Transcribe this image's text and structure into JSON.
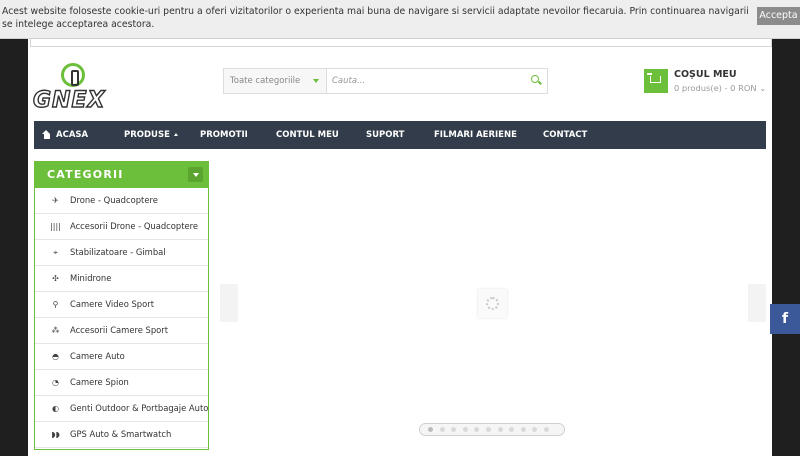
{
  "cookie_bar": {
    "text": "Acest website foloseste cookie-uri pentru a oferi vizitatorilor o experienta mai buna de navigare si servicii adaptate nevoilor fiecaruia. Prin continuarea navigarii se intelege acceptarea acestora.",
    "accept_label": "Accepta"
  },
  "header": {
    "logo_text": "GNEX",
    "search": {
      "category_selected": "Toate categoriile",
      "placeholder": "Cauta..."
    },
    "cart": {
      "title": "COȘUL MEU",
      "summary": "0 produs(e) - 0 RON ⌄"
    }
  },
  "nav": {
    "items": [
      {
        "label": "ACASA",
        "icon": "home-icon"
      },
      {
        "label": "PRODUSE",
        "has_dropdown": true
      },
      {
        "label": "PROMOTII"
      },
      {
        "label": "CONTUL MEU"
      },
      {
        "label": "SUPORT"
      },
      {
        "label": "FILMARI AERIENE"
      },
      {
        "label": "CONTACT"
      }
    ]
  },
  "categories": {
    "title": "CATEGORII",
    "items": [
      {
        "label": "Drone - Quadcoptere",
        "icon": "drone-icon",
        "glyph": "✈"
      },
      {
        "label": "Accesorii Drone - Quadcoptere",
        "icon": "drone-accessories-icon",
        "glyph": "||||"
      },
      {
        "label": "Stabilizatoare - Gimbal",
        "icon": "gimbal-icon",
        "glyph": "⌖"
      },
      {
        "label": "Minidrone",
        "icon": "minidrone-icon",
        "glyph": "✣"
      },
      {
        "label": "Camere Video Sport",
        "icon": "sport-camera-icon",
        "glyph": "⚲"
      },
      {
        "label": "Accesorii Camere Sport",
        "icon": "camera-accessories-icon",
        "glyph": "⁂"
      },
      {
        "label": "Camere Auto",
        "icon": "car-camera-icon",
        "glyph": "◓"
      },
      {
        "label": "Camere Spion",
        "icon": "spy-camera-icon",
        "glyph": "◔"
      },
      {
        "label": "Genti Outdoor & Portbagaje Auto",
        "icon": "bag-icon",
        "glyph": "◐"
      },
      {
        "label": "GPS Auto & Smartwatch",
        "icon": "gps-watch-icon",
        "glyph": "◗◗"
      }
    ]
  },
  "slider": {
    "page_count": 11,
    "active_page": 1
  },
  "colors": {
    "accent": "#6cbf3b",
    "nav_bg": "#323c4a",
    "facebook": "#3b5998"
  }
}
